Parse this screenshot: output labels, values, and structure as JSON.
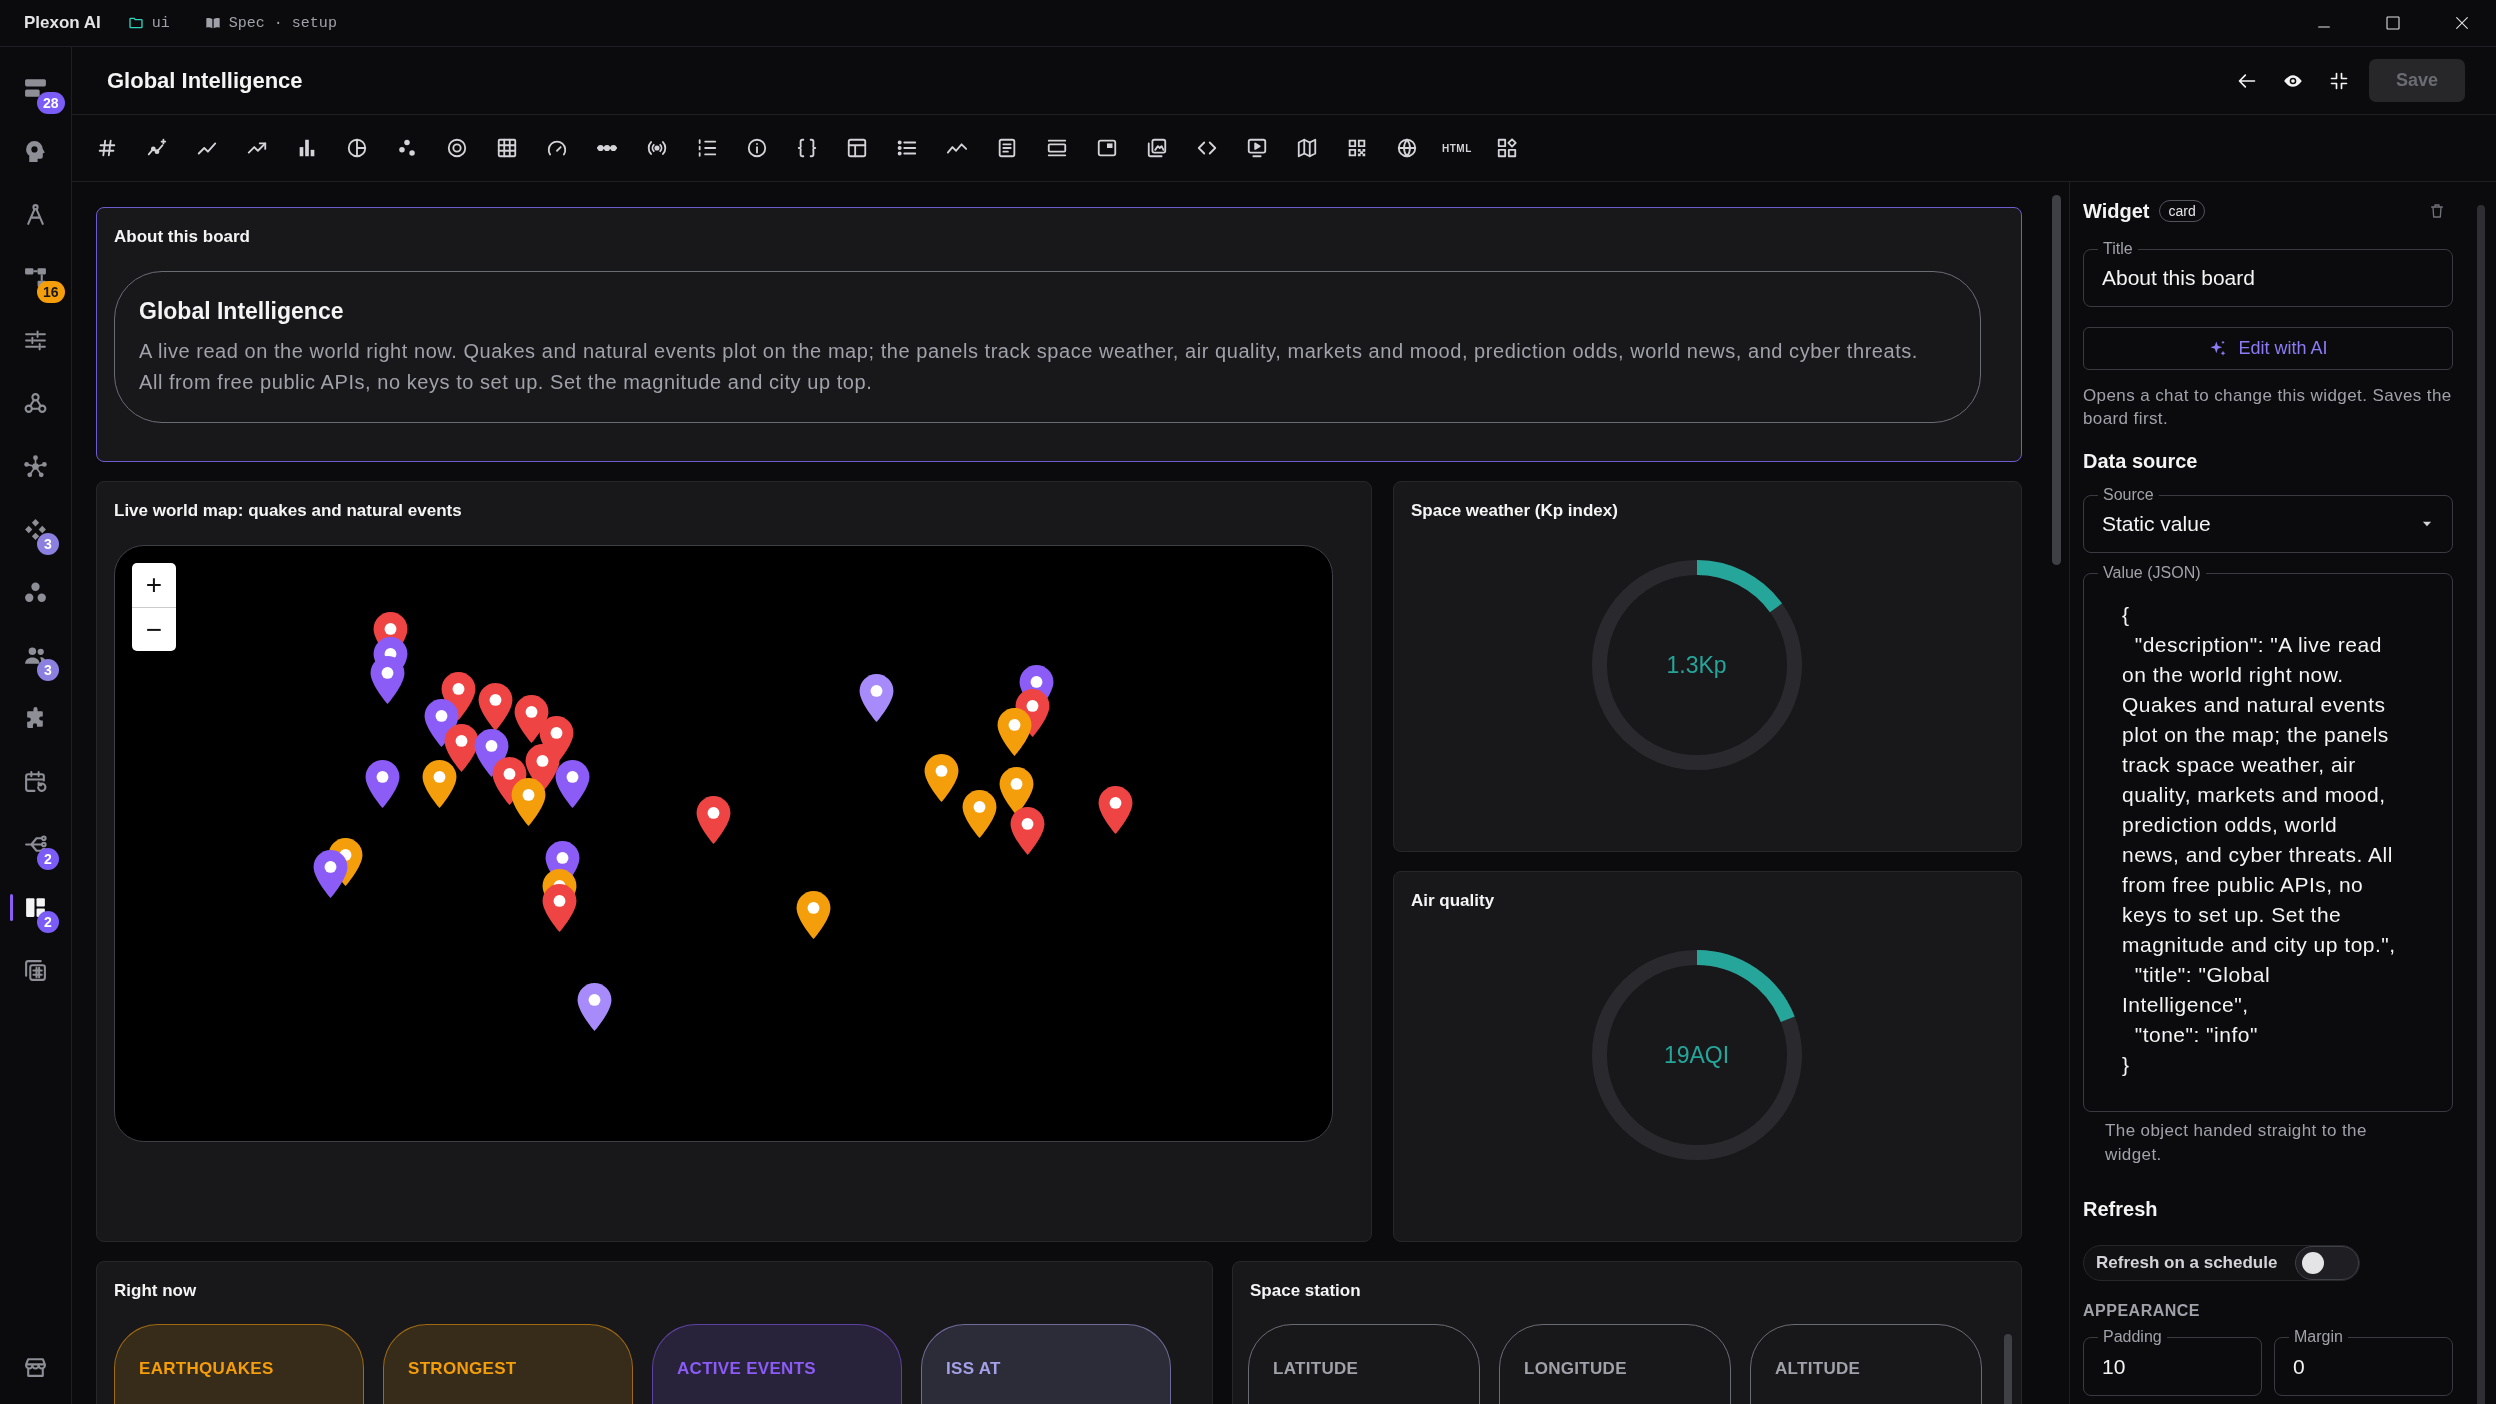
{
  "titlebar": {
    "app_name": "Plexon AI",
    "folder": "ui",
    "spec": "Spec · setup"
  },
  "sidebar": {
    "items": [
      {
        "selected": false,
        "badge": "28",
        "color": "#7c5cf6"
      },
      {
        "selected": false
      },
      {
        "selected": false
      },
      {
        "selected": false,
        "badge": "16",
        "color": "#f59e0b"
      },
      {
        "selected": false
      },
      {
        "selected": false
      },
      {
        "selected": false
      },
      {
        "selected": false,
        "badge": "3",
        "color": "#8b80e0"
      },
      {
        "selected": false
      },
      {
        "selected": false,
        "badge": "3",
        "color": "#8b80e0"
      },
      {
        "selected": false
      },
      {
        "selected": false
      },
      {
        "selected": false,
        "badge": "2",
        "color": "#7c5cf6"
      },
      {
        "selected": true,
        "badge": "2",
        "color": "#7c5cf6"
      },
      {
        "selected": false
      }
    ]
  },
  "header": {
    "title": "Global Intelligence",
    "save": {
      "label": "Save",
      "disabled": true
    }
  },
  "toolbar": {
    "html_label": "HTML"
  },
  "about": {
    "selected": true,
    "title": "About this board",
    "heading": "Global Intelligence",
    "description": "A live read on the world right now. Quakes and natural events plot on the map; the panels track space weather, air quality, markets and mood, prediction odds, world news, and cyber threats. All from free public APIs, no keys to set up. Set the magnitude and city up top."
  },
  "map": {
    "selected": false,
    "title": "Live world map: quakes and natural events",
    "zoom_in": "+",
    "zoom_out": "−",
    "markers": [
      {
        "color": "#ef4444"
      },
      {
        "color": "#8b5cf6"
      },
      {
        "color": "#8b5cf6"
      },
      {
        "color": "#ef4444"
      },
      {
        "color": "#ef4444"
      },
      {
        "color": "#8b5cf6"
      },
      {
        "color": "#ef4444"
      },
      {
        "color": "#ef4444"
      },
      {
        "color": "#ef4444"
      },
      {
        "color": "#ef4444"
      },
      {
        "color": "#8b5cf6"
      },
      {
        "color": "#ef4444"
      },
      {
        "color": "#8b5cf6"
      },
      {
        "color": "#f59e0b"
      },
      {
        "color": "#f59e0b"
      },
      {
        "color": "#8b5cf6"
      },
      {
        "color": "#f59e0b"
      },
      {
        "color": "#8b5cf6"
      },
      {
        "color": "#8b5cf6"
      },
      {
        "color": "#f59e0b"
      },
      {
        "color": "#ef4444"
      },
      {
        "color": "#a78bfa"
      },
      {
        "color": "#ef4444"
      },
      {
        "color": "#f59e0b"
      },
      {
        "color": "#a78bfa"
      },
      {
        "color": "#8b5cf6"
      },
      {
        "color": "#ef4444"
      },
      {
        "color": "#f59e0b"
      },
      {
        "color": "#f59e0b"
      },
      {
        "color": "#f59e0b"
      },
      {
        "color": "#f59e0b"
      },
      {
        "color": "#ef4444"
      },
      {
        "color": "#ef4444"
      }
    ]
  },
  "space_weather": {
    "selected": false,
    "title": "Space weather (Kp index)",
    "reading": "1.3Kp",
    "level": 0.15
  },
  "air_quality": {
    "selected": false,
    "title": "Air quality",
    "reading": "19AQI",
    "level": 0.19
  },
  "right_now": {
    "selected": false,
    "title": "Right now",
    "stats": [
      {
        "label": "EARTHQUAKES",
        "color": "#f59e0b"
      },
      {
        "label": "STRONGEST",
        "color": "#f59e0b"
      },
      {
        "label": "ACTIVE EVENTS",
        "color": "#8b5cf6"
      },
      {
        "label": "ISS AT",
        "color": "#a5a1e8"
      }
    ]
  },
  "space_station": {
    "selected": false,
    "title": "Space station",
    "stats": [
      {
        "label": "LATITUDE"
      },
      {
        "label": "LONGITUDE"
      },
      {
        "label": "ALTITUDE"
      }
    ]
  },
  "inspector": {
    "heading": "Widget",
    "type_badge": "card",
    "title_field": {
      "label": "Title",
      "value": "About this board"
    },
    "edit_ai": "Edit with AI",
    "edit_ai_help": "Opens a chat to change this widget. Saves the board first.",
    "data_source_heading": "Data source",
    "source_field": {
      "label": "Source",
      "value": "Static value"
    },
    "value_field": {
      "label": "Value (JSON)",
      "value": "{\n  \"description\": \"A live read on the world right now. Quakes and natural events plot on the map; the panels track space weather, air quality, markets and mood, prediction odds, world news, and cyber threats. All from free public APIs, no keys to set up. Set the magnitude and city up top.\",\n  \"title\": \"Global Intelligence\",\n  \"tone\": \"info\"\n}"
    },
    "value_help": "The object handed straight to the widget.",
    "refresh_heading": "Refresh",
    "schedule": {
      "label": "Refresh on a schedule",
      "on": false
    },
    "appearance_heading": "APPEARANCE",
    "padding_field": {
      "label": "Padding",
      "value": "10"
    },
    "margin_field": {
      "label": "Margin",
      "value": "0"
    }
  }
}
